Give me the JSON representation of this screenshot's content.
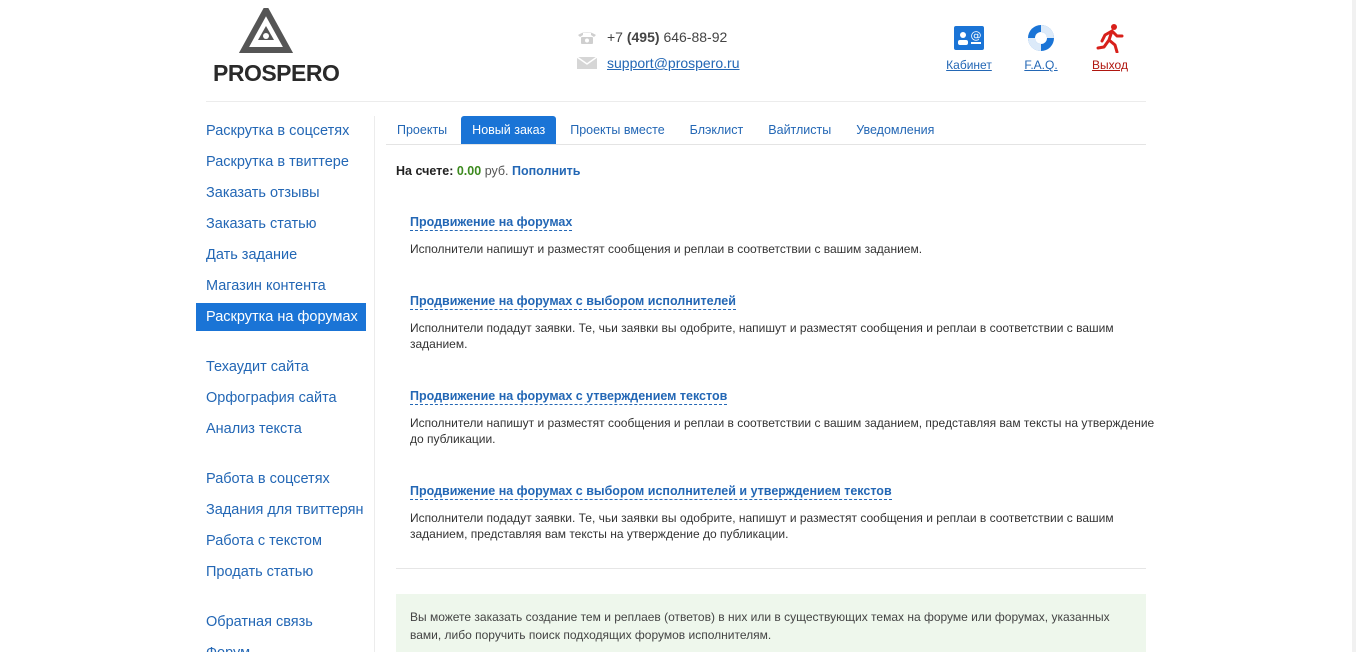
{
  "header": {
    "logo_text": "PROSPERO",
    "phone": {
      "prefix": "+7",
      "code": "(495)",
      "number": "646-88-92"
    },
    "email": "support@prospero.ru",
    "links": [
      {
        "label": "Кабинет",
        "icon": "cabinet-icon"
      },
      {
        "label": "F.A.Q.",
        "icon": "lifebuoy-icon"
      },
      {
        "label": "Выход",
        "icon": "exit-running-man-icon"
      }
    ]
  },
  "colors": {
    "link": "#2367b5",
    "active": "#1a74d6",
    "exit": "#b0160f",
    "amount": "#3c8a1e",
    "infobox": "#eef7ec"
  },
  "sidebar": {
    "group1": [
      "Раскрутка в соцсетях",
      "Раскрутка в твиттере",
      "Заказать отзывы",
      "Заказать статью",
      "Дать задание",
      "Магазин контента",
      "Раскрутка на форумах"
    ],
    "active": "Раскрутка на форумах",
    "group2": [
      "Техаудит сайта",
      "Орфография сайта",
      "Анализ текста"
    ],
    "group3": [
      "Работа в соцсетях",
      "Задания для твиттерян",
      "Работа с текстом",
      "Продать статью"
    ],
    "group4": [
      "Обратная связь",
      "Форум"
    ]
  },
  "tabs": [
    "Проекты",
    "Новый заказ",
    "Проекты вместе",
    "Блэклист",
    "Вайтлисты",
    "Уведомления"
  ],
  "active_tab": "Новый заказ",
  "balance": {
    "label": "На счете:",
    "amount": "0.00",
    "currency": "руб.",
    "topup": "Пополнить"
  },
  "options": [
    {
      "title": "Продвижение на форумах",
      "desc": "Исполнители напишут и разместят сообщения и реплаи в соответствии с вашим заданием."
    },
    {
      "title": "Продвижение на форумах с выбором исполнителей",
      "desc": "Исполнители подадут заявки. Те, чьи заявки вы одобрите, напишут и разместят сообщения и реплаи в соответствии с вашим заданием."
    },
    {
      "title": "Продвижение на форумах с утверждением текстов",
      "desc": "Исполнители напишут и разместят сообщения и реплаи в соответствии с вашим заданием, представляя вам тексты на утверждение до публикации."
    },
    {
      "title": "Продвижение на форумах с выбором исполнителей и утверждением текстов",
      "desc": "Исполнители подадут заявки. Те, чьи заявки вы одобрите, напишут и разместят сообщения и реплаи в соответствии с вашим заданием, представляя вам тексты на утверждение до публикации."
    }
  ],
  "info": "Вы можете заказать создание тем и реплаев (ответов) в них или в существующих темах на форуме или форумах, указанных вами, либо поручить поиск подходящих форумов исполнителям."
}
